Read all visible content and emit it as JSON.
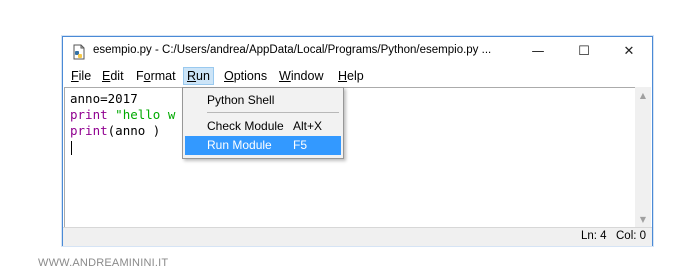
{
  "window": {
    "title": "esempio.py - C:/Users/andrea/AppData/Local/Programs/Python/esempio.py ...",
    "controls": {
      "minimize": "—",
      "maximize": "☐",
      "close": "✕"
    }
  },
  "menubar": {
    "items": [
      {
        "accel": "F",
        "rest": "ile"
      },
      {
        "accel": "E",
        "rest": "dit"
      },
      {
        "pre": "F",
        "accel": "o",
        "rest": "rmat"
      },
      {
        "accel": "R",
        "rest": "un"
      },
      {
        "accel": "O",
        "rest": "ptions"
      },
      {
        "accel": "W",
        "rest": "indow"
      },
      {
        "accel": "H",
        "rest": "elp"
      }
    ]
  },
  "editor": {
    "lines": [
      {
        "plain": "anno=2017"
      },
      {
        "kw": "print",
        "str": " \"hello w"
      },
      {
        "kw": "print",
        "plain": "(anno )"
      }
    ]
  },
  "run_menu": {
    "items": [
      {
        "label": "Python Shell",
        "shortcut": ""
      },
      {
        "label": "Check Module",
        "shortcut": "Alt+X"
      },
      {
        "label": "Run Module",
        "shortcut": "F5"
      }
    ]
  },
  "statusbar": {
    "line": "Ln: 4",
    "col": "Col: 0"
  },
  "watermark": "WWW.ANDREAMININI.IT",
  "colors": {
    "keyword": "#900090",
    "string": "#00aa00",
    "highlight": "#3399ff",
    "window_border": "#4a8ad6"
  }
}
